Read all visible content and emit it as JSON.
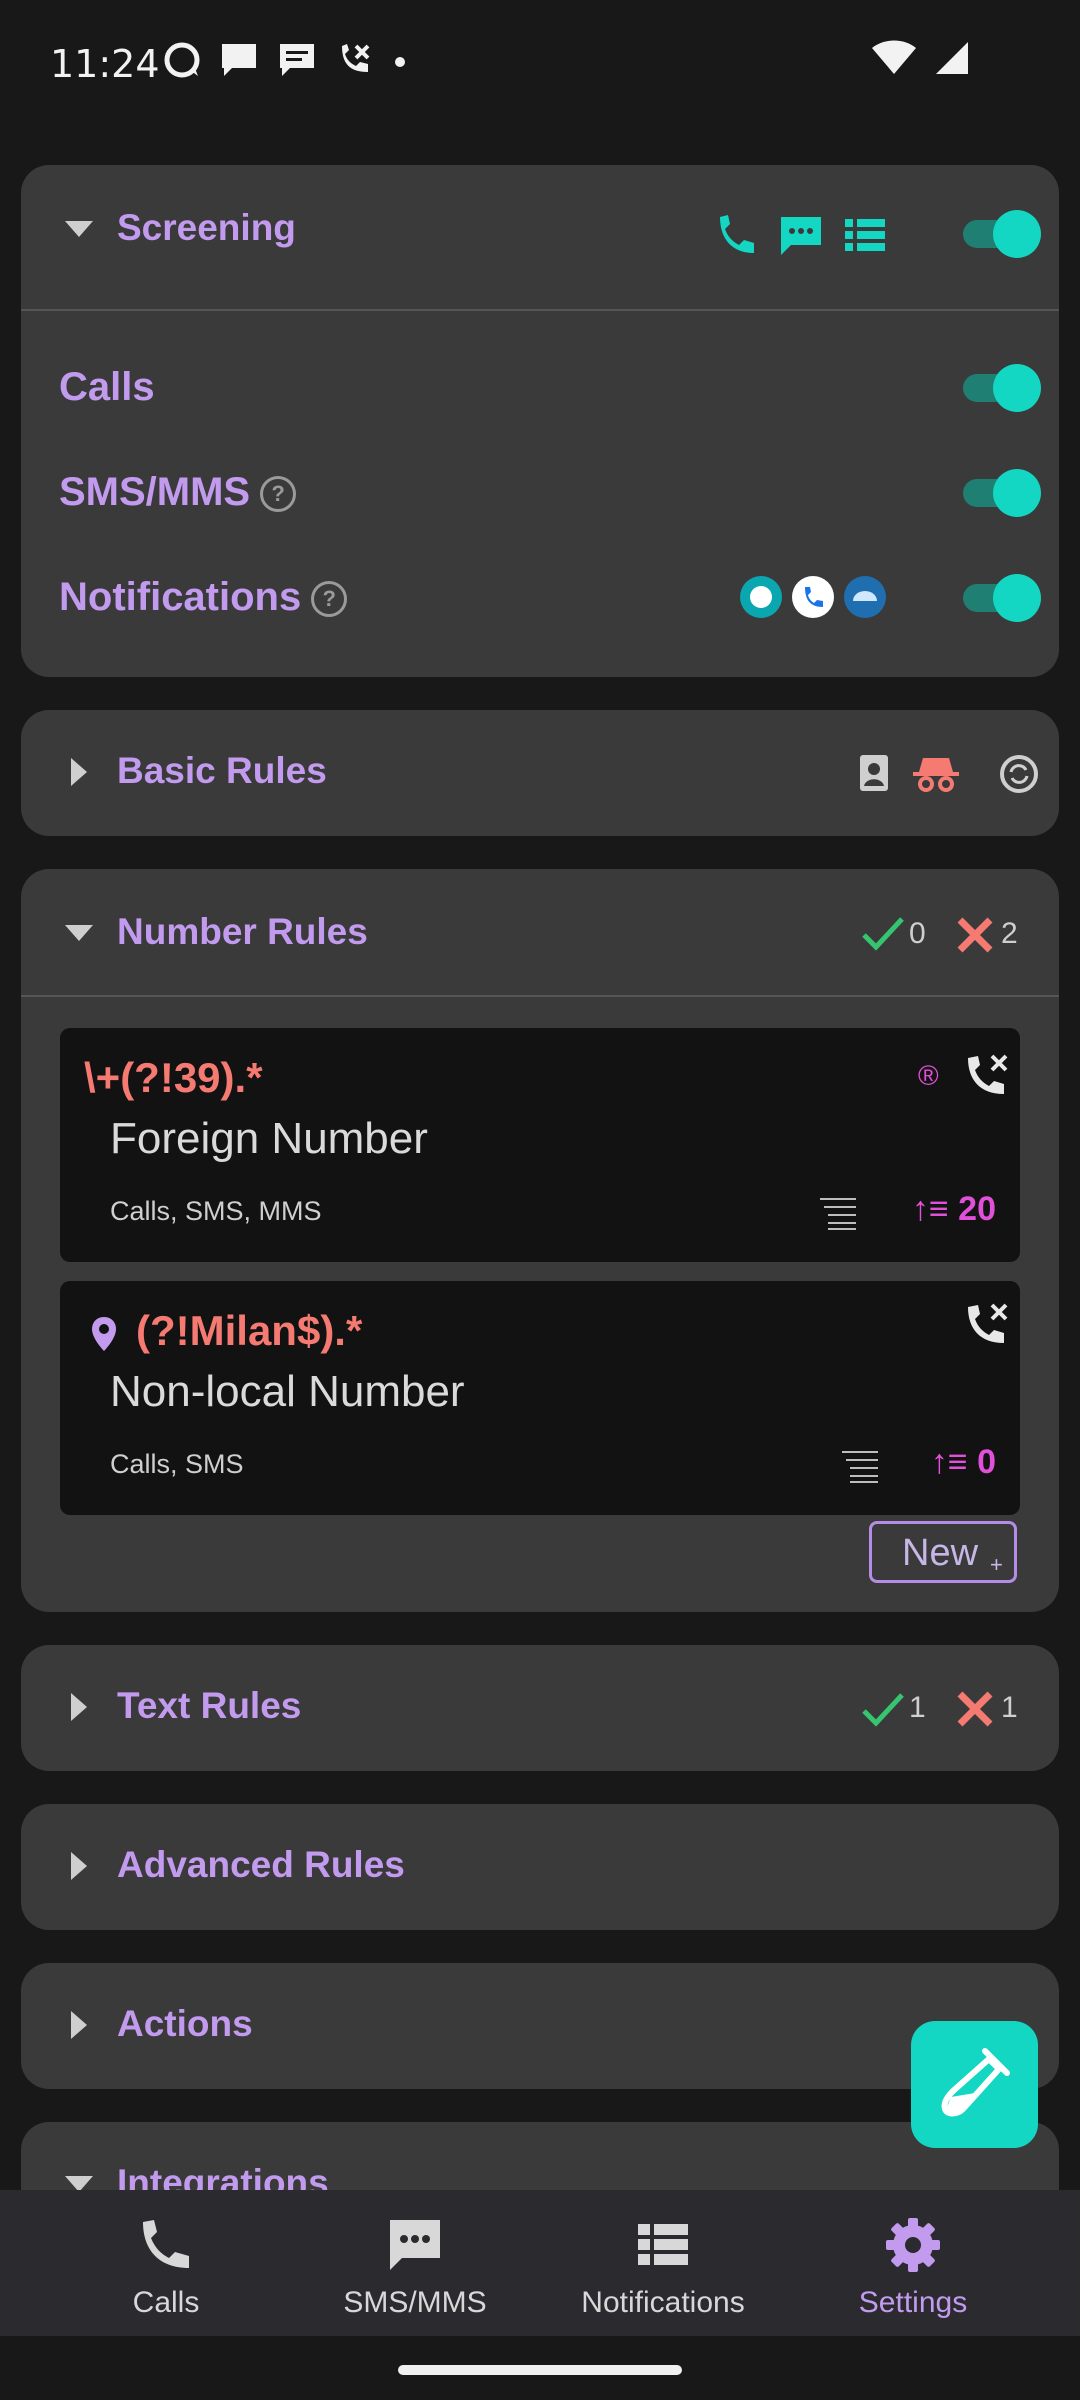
{
  "status": {
    "time": "11:24"
  },
  "screening": {
    "title": "Screening",
    "rows": [
      {
        "label": "Calls"
      },
      {
        "label": "SMS/MMS",
        "help": "?"
      },
      {
        "label": "Notifications",
        "help": "?"
      }
    ]
  },
  "basic_rules": {
    "title": "Basic Rules"
  },
  "number_rules": {
    "title": "Number Rules",
    "allow_count": "0",
    "block_count": "2",
    "rules": [
      {
        "pattern": "\\+(?!39).*",
        "description": "Foreign Number",
        "types": "Calls, SMS, MMS",
        "priority": "20",
        "badge": "®"
      },
      {
        "pattern": "(?!Milan$).*",
        "description": "Non-local Number",
        "types": "Calls, SMS",
        "priority": "0"
      }
    ],
    "new_label": "New",
    "new_plus": "+"
  },
  "text_rules": {
    "title": "Text Rules",
    "allow_count": "1",
    "block_count": "1"
  },
  "advanced_rules": {
    "title": "Advanced Rules"
  },
  "actions": {
    "title": "Actions"
  },
  "integrations": {
    "title": "Integrations"
  },
  "nav": {
    "items": [
      {
        "label": "Calls"
      },
      {
        "label": "SMS/MMS"
      },
      {
        "label": "Notifications"
      },
      {
        "label": "Settings"
      }
    ],
    "active": "Settings"
  },
  "colors": {
    "accent": "#c29bef",
    "teal": "#13d6c3",
    "red": "#f57a72",
    "magenta": "#e150d8"
  }
}
